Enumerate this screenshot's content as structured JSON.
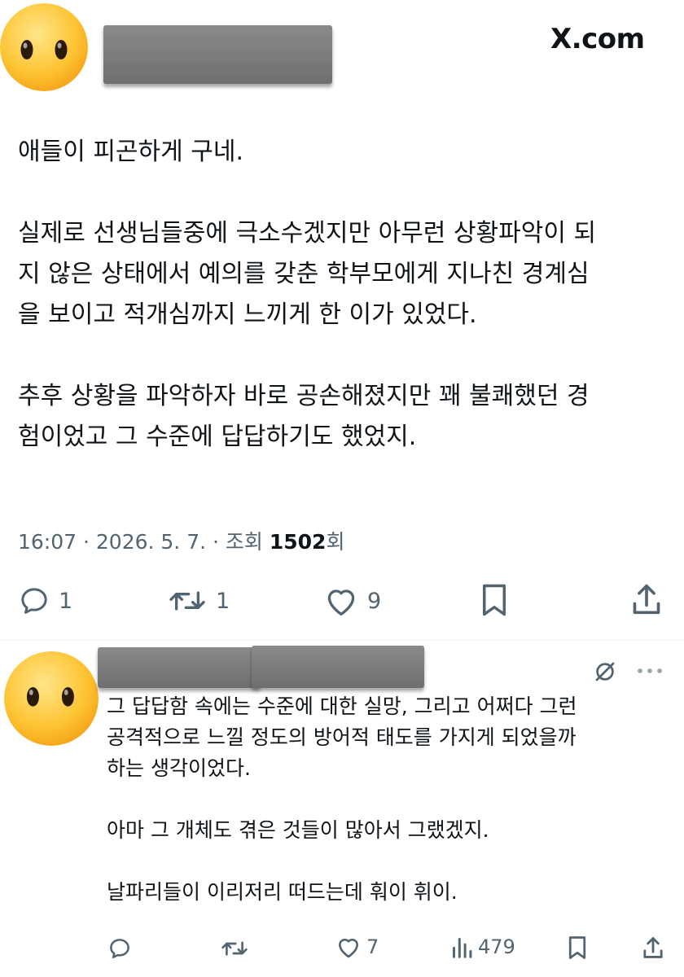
{
  "brand": {
    "label": "X.com"
  },
  "tweet": {
    "paragraphs": [
      "애들이 피곤하게 구네.",
      "실제로 선생님들중에 극소수겠지만 아무런 상황파악이 되\n지 않은 상태에서 예의를 갖춘 학부모에게 지나친 경계심\n을 보이고 적개심까지 느끼게 한 이가 있었다.",
      "추후 상황을 파악하자 바로 공손해졌지만 꽤 불쾌했던 경\n험이었고 그 수준에 답답하기도 했었지."
    ],
    "meta": {
      "timestamp": "16:07 · 2026. 5. 7. · 조회 ",
      "views": "1502",
      "views_suffix": "회"
    },
    "actions": {
      "reply_count": "1",
      "retweet_count": "1",
      "like_count": "9"
    }
  },
  "reply": {
    "paragraphs": [
      "그 답답함 속에는 수준에 대한 실망, 그리고 어쩌다 그런\n공격적으로 느낄 정도의 방어적 태도를 가지게 되었을까\n하는 생각이었다.",
      "아마 그 개체도 겪은 것들이 많아서 그랬겠지.",
      "날파리들이 이리저리 떠드는데 훠이 휘이."
    ],
    "actions": {
      "like_count": "7",
      "views_count": "479"
    }
  },
  "icons": {
    "avatar": "neutral-face-emoji",
    "reply": "speech-bubble-icon",
    "retweet": "retweet-icon",
    "like": "heart-icon",
    "bookmark": "bookmark-icon",
    "share": "share-icon",
    "views": "bar-chart-icon",
    "grok": "slashed-circle-icon",
    "more": "more-dots-icon"
  },
  "colors": {
    "text": "#0f1419",
    "secondary": "#536471"
  }
}
